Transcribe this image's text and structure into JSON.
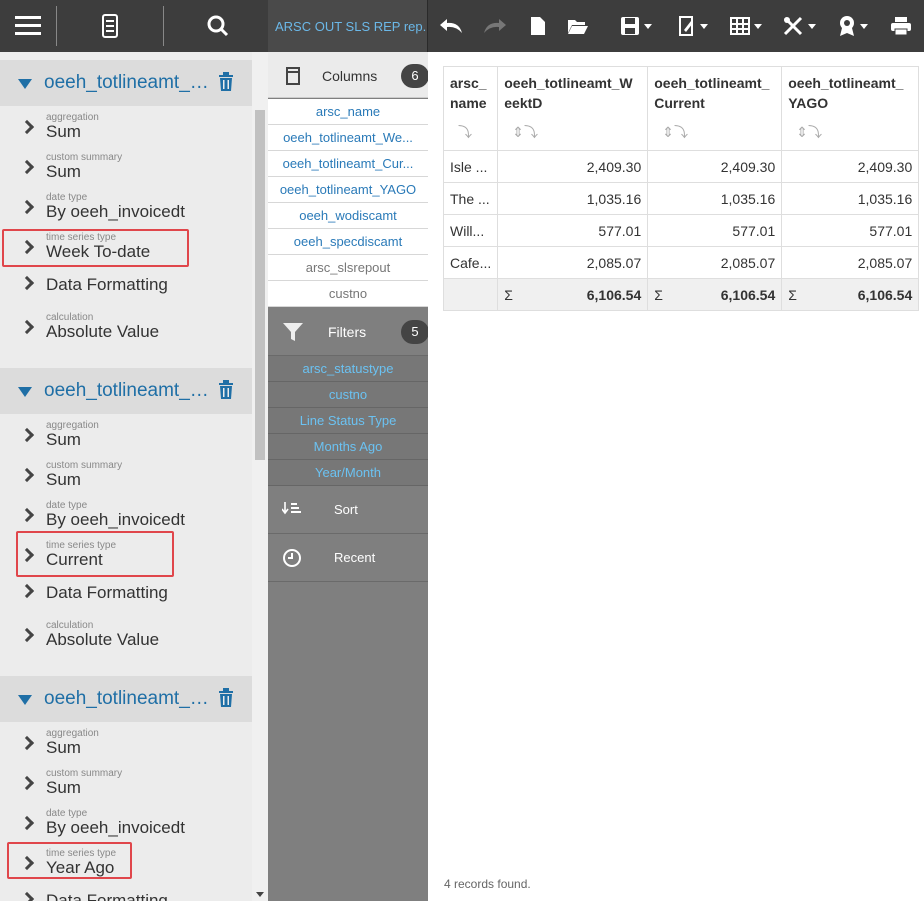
{
  "report_tab": "ARSC OUT SLS REP rep...",
  "groups": [
    {
      "title": "oeeh_totlineamt_WeekToDate",
      "props": [
        {
          "small": "aggregation",
          "value": "Sum"
        },
        {
          "small": "custom summary",
          "value": "Sum"
        },
        {
          "small": "date type",
          "value": "By oeeh_invoicedt"
        },
        {
          "small": "time series type",
          "value": "Week To-date"
        },
        {
          "small": "",
          "value": "Data Formatting"
        },
        {
          "small": "calculation",
          "value": "Absolute Value"
        }
      ]
    },
    {
      "title": "oeeh_totlineamt_Current",
      "props": [
        {
          "small": "aggregation",
          "value": "Sum"
        },
        {
          "small": "custom summary",
          "value": "Sum"
        },
        {
          "small": "date type",
          "value": "By oeeh_invoicedt"
        },
        {
          "small": "time series type",
          "value": "Current"
        },
        {
          "small": "",
          "value": "Data Formatting"
        },
        {
          "small": "calculation",
          "value": "Absolute Value"
        }
      ]
    },
    {
      "title": "oeeh_totlineamt_YAGO",
      "props": [
        {
          "small": "aggregation",
          "value": "Sum"
        },
        {
          "small": "custom summary",
          "value": "Sum"
        },
        {
          "small": "date type",
          "value": "By oeeh_invoicedt"
        },
        {
          "small": "time series type",
          "value": "Year Ago"
        },
        {
          "small": "",
          "value": "Data Formatting"
        }
      ]
    }
  ],
  "columns_section": {
    "label": "Columns",
    "count": "6"
  },
  "columns": [
    "arsc_name",
    "oeeh_totlineamt_We...",
    "oeeh_totlineamt_Cur...",
    "oeeh_totlineamt_YAGO",
    "oeeh_wodiscamt",
    "oeeh_specdiscamt",
    "arsc_slsrepout",
    "custno"
  ],
  "filters_section": {
    "label": "Filters",
    "count": "5"
  },
  "filters": [
    "arsc_statustype",
    "custno",
    "Line Status Type",
    "Months Ago",
    "Year/Month"
  ],
  "sort_label": "Sort",
  "recent_label": "Recent",
  "table": {
    "headers": [
      "arsc_\nname",
      "oeeh_totlineamt_W\neektD",
      "oeeh_totlineamt_\nCurrent",
      "oeeh_totlineamt_\nYAGO"
    ],
    "rows": [
      [
        "Isle ...",
        "2,409.30",
        "2,409.30",
        "2,409.30"
      ],
      [
        "The ...",
        "1,035.16",
        "1,035.16",
        "1,035.16"
      ],
      [
        "Will...",
        "577.01",
        "577.01",
        "577.01"
      ],
      [
        "Cafe...",
        "2,085.07",
        "2,085.07",
        "2,085.07"
      ]
    ],
    "totals": [
      "",
      "6,106.54",
      "6,106.54",
      "6,106.54"
    ],
    "sum_symbol": "Σ"
  },
  "records_found": "4 records found."
}
